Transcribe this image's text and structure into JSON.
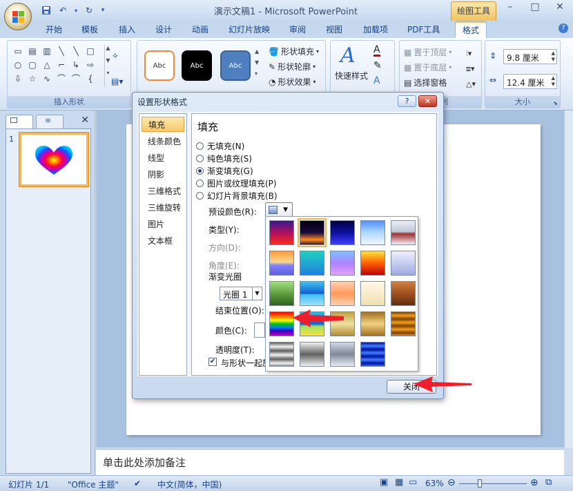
{
  "titlebar": {
    "window_title": "演示文稿1 - Microsoft PowerPoint",
    "context_tab": "绘图工具"
  },
  "tabs": [
    "开始",
    "模板",
    "插入",
    "设计",
    "动画",
    "幻灯片放映",
    "审阅",
    "视图",
    "加载项",
    "PDF工具",
    "格式"
  ],
  "active_tab": "格式",
  "ribbon": {
    "insert_shapes_label": "插入形状",
    "style_sample": "Abc",
    "shape_fill": "形状填充",
    "shape_outline": "形状轮廓",
    "shape_effects": "形状效果",
    "quick_styles": "快速样式",
    "bring_to_front": "置于顶层",
    "send_to_back": "置于底层",
    "selection_pane": "选择窗格",
    "arrange_label_fragment": "列",
    "height": "9.8 厘米",
    "width": "12.4 厘米",
    "size_label": "大小"
  },
  "slide_pane": {
    "slide_number": "1"
  },
  "notes_placeholder": "单击此处添加备注",
  "statusbar": {
    "slide_info": "幻灯片 1/1",
    "theme": "\"Office 主题\"",
    "language": "中文(简体，中国)",
    "zoom": "63%"
  },
  "dialog": {
    "title": "设置形状格式",
    "help": "?",
    "close_x": "✕",
    "categories": [
      "填充",
      "线条颜色",
      "线型",
      "阴影",
      "三维格式",
      "三维旋转",
      "图片",
      "文本框"
    ],
    "selected_category": "填充",
    "section_title": "填充",
    "fill_options": [
      {
        "label": "无填充(N)",
        "selected": false
      },
      {
        "label": "纯色填充(S)",
        "selected": false
      },
      {
        "label": "渐变填充(G)",
        "selected": true
      },
      {
        "label": "图片或纹理填充(P)",
        "selected": false
      },
      {
        "label": "幻灯片背景填充(B)",
        "selected": false
      }
    ],
    "preset_colors": "预设颜色(R):",
    "type": "类型(Y):",
    "direction": "方向(D):",
    "angle": "角度(E):",
    "gradient_stops": "渐变光圈",
    "stop_value": "光圈 1",
    "end_position": "结束位置(O):",
    "color": "颜色(C):",
    "transparency": "透明度(T):",
    "rotate_with_shape": "与形状一起旋",
    "close_button": "关闭"
  },
  "gradient_presets": [
    [
      "linear-gradient(#3a1a8a,#b01060,#ff2a1a)",
      "linear-gradient(#000010,#1a0a3a 50%,#ff8a1a 80%,#3a1a3a)",
      "linear-gradient(#000040,#1010a0,#4040ff)",
      "linear-gradient(#5090ff,#b0d8ff,#f0f8ff)",
      "linear-gradient(#e8eef8,#c0c8d8 45%,#a03030 55%,#f0f0f8)"
    ],
    [
      "linear-gradient(#ff9a3a,#ffd890 45%,#8080ff 60%,#6060e0)",
      "linear-gradient(#20d0c0,#2080e0)",
      "linear-gradient(#80c0ff,#b080ff,#e0a0ff)",
      "linear-gradient(#ffe040,#ff6000,#c00000)",
      "linear-gradient(#f0f0ff,#a0a8e0)"
    ],
    [
      "linear-gradient(#a0e080,#60a040,#306020)",
      "linear-gradient(#40c0f0,#1060d0 50%,#40c0f0 55%,#a0e0ff)",
      "linear-gradient(#ffd0b0,#ff9a5a,#ffd0b0)",
      "linear-gradient(#fff8e8,#f0e0b0)",
      "linear-gradient(#d08040,#a05020,#603010)"
    ],
    [
      "linear-gradient(#ff0000,#ff8000 20%,#ffff00 35%,#00c000 50%,#0080ff 65%,#4000c0 80%,#c000c0)",
      "linear-gradient(#20c0f0,#1060d0 50%,#a0e060 60%,#ffe040)",
      "linear-gradient(#c0a040,#f0e0a0 50%,#b09030)",
      "linear-gradient(#a07020,#f0d080 50%,#a07020)",
      "repeating-linear-gradient(#804000 0,#f0a020 5px,#804000 10px)"
    ],
    [
      "repeating-linear-gradient(#606060 0,#f0f0f0 6px,#606060 12px)",
      "linear-gradient(#f0f0f0,#606060 50%,#f0f0f0)",
      "linear-gradient(#d0d8e8,#808898 50%,#e8ecf4)",
      "repeating-linear-gradient(#0010a0 0,#4080ff 5px,#0010a0 10px)"
    ]
  ]
}
